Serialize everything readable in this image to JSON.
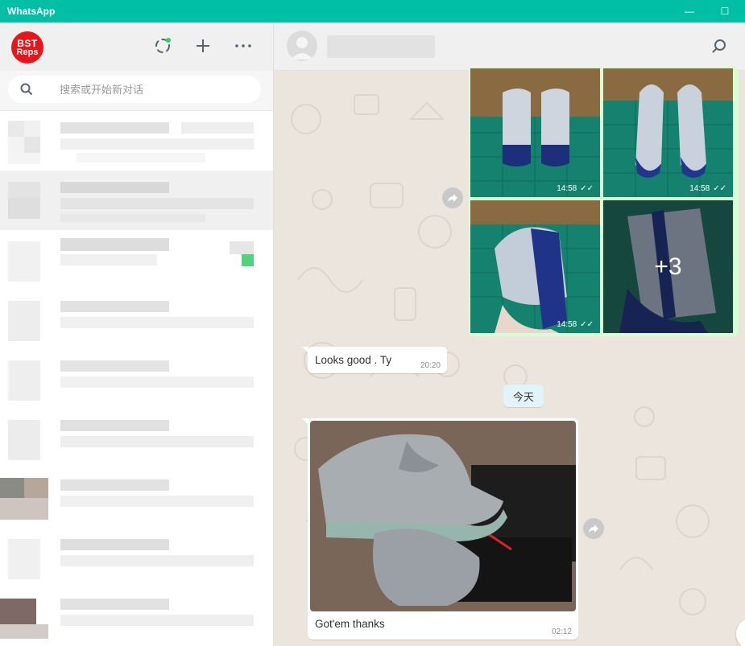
{
  "window": {
    "title": "WhatsApp",
    "minimize": "—",
    "maximize": "☐"
  },
  "sidebar": {
    "logo": {
      "line1": "BST",
      "line2": "Reps"
    },
    "icons": [
      "status-icon",
      "new-chat-icon",
      "menu-icon"
    ],
    "search": {
      "placeholder": "搜索或开始新对话"
    }
  },
  "conversation": {
    "header_icons": [
      "search-icon"
    ],
    "album": {
      "tiles": [
        {
          "time": "14:58",
          "status": "read"
        },
        {
          "time": "14:58",
          "status": "read"
        },
        {
          "time": "14:58",
          "status": "read"
        },
        {
          "more_count": "+3"
        }
      ]
    },
    "messages": [
      {
        "text": "Looks good . Ty",
        "time": "20:20"
      },
      {
        "text": "Got'em thanks",
        "time": "02:12"
      }
    ],
    "date_separator": "今天"
  },
  "colors": {
    "titlebar": "#00bfa5",
    "chat_bg": "#ece5dd",
    "outgoing": "#d9fdd3",
    "logo": "#e8151b"
  }
}
